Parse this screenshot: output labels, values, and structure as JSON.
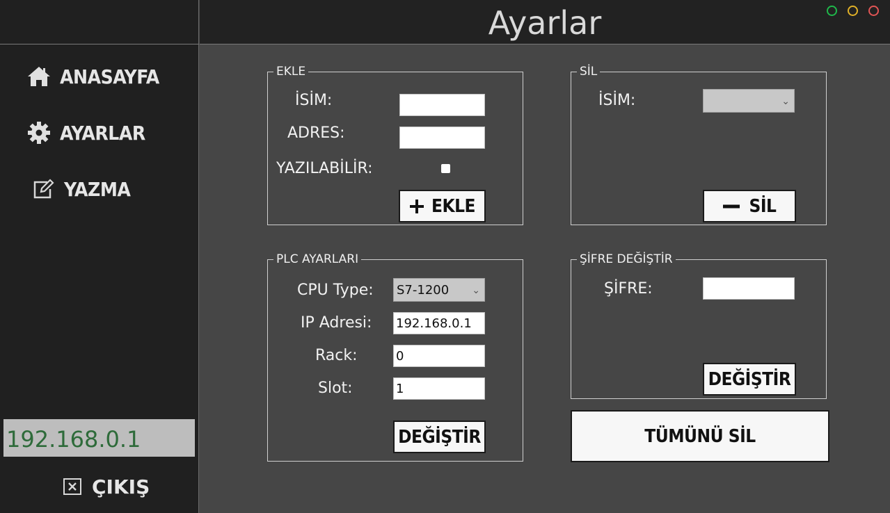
{
  "header": {
    "title": "Ayarlar"
  },
  "window_controls": {
    "colors": [
      "#1fb84a",
      "#e0b128",
      "#e25555"
    ]
  },
  "sidebar": {
    "items": [
      {
        "label": "ANASAYFA",
        "icon": "home-icon"
      },
      {
        "label": "AYARLAR",
        "icon": "gear-icon"
      },
      {
        "label": "YAZMA",
        "icon": "edit-icon"
      }
    ],
    "ip": "192.168.0.1",
    "exit_label": "ÇIKIŞ"
  },
  "ekle": {
    "title": "EKLE",
    "name_label": "İSİM:",
    "address_label": "ADRES:",
    "writable_label": "YAZILABİLİR:",
    "name_value": "",
    "address_value": "",
    "button": "EKLE"
  },
  "sil": {
    "title": "SİL",
    "name_label": "İSİM:",
    "selected": "",
    "button": "SİL"
  },
  "plc": {
    "title": "PLC AYARLARI",
    "cpu_label": "CPU Type:",
    "cpu_value": "S7-1200",
    "ip_label": "IP Adresi:",
    "ip_value": "192.168.0.1",
    "rack_label": "Rack:",
    "rack_value": "0",
    "slot_label": "Slot:",
    "slot_value": "1",
    "button": "DEĞİŞTİR"
  },
  "sifre": {
    "title": "ŞİFRE DEĞİŞTİR",
    "label": "ŞİFRE:",
    "value": "",
    "button": "DEĞİŞTİR"
  },
  "delete_all": "TÜMÜNÜ SİL"
}
